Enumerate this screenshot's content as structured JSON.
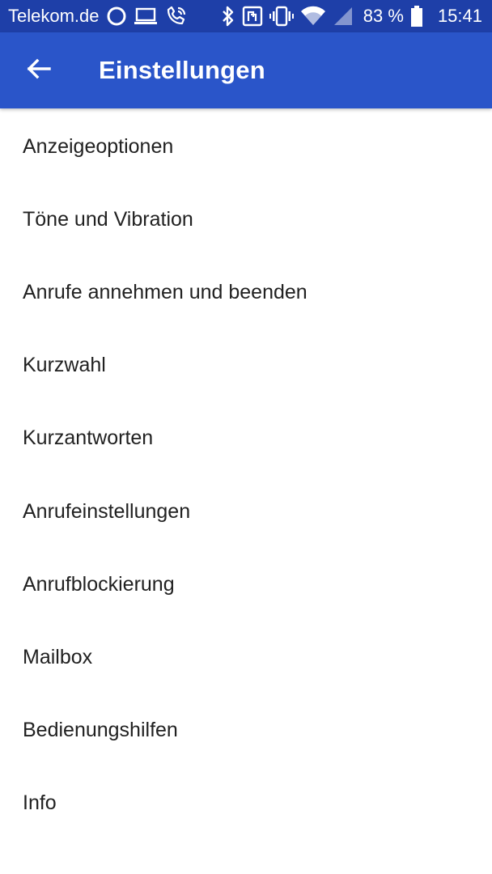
{
  "status_bar": {
    "carrier": "Telekom.de",
    "battery_percent": "83 %",
    "time": "15:41",
    "icons": [
      "assistant-ring-icon",
      "laptop-icon",
      "wifi-calling-icon",
      "bluetooth-icon",
      "nfc-icon",
      "vibrate-icon",
      "wifi-icon",
      "cell-signal-icon",
      "battery-icon"
    ]
  },
  "app_bar": {
    "title": "Einstellungen",
    "back_icon": "arrow-back-icon"
  },
  "settings": {
    "items": [
      {
        "label": "Anzeigeoptionen"
      },
      {
        "label": "Töne und Vibration"
      },
      {
        "label": "Anrufe annehmen und beenden"
      },
      {
        "label": "Kurzwahl"
      },
      {
        "label": "Kurzantworten"
      },
      {
        "label": "Anrufeinstellungen"
      },
      {
        "label": "Anrufblockierung"
      },
      {
        "label": "Mailbox"
      },
      {
        "label": "Bedienungshilfen"
      },
      {
        "label": "Info"
      }
    ]
  },
  "colors": {
    "status_bar": "#1e3fa8",
    "app_bar": "#2a55c9",
    "text": "#212121",
    "background": "#ffffff"
  }
}
